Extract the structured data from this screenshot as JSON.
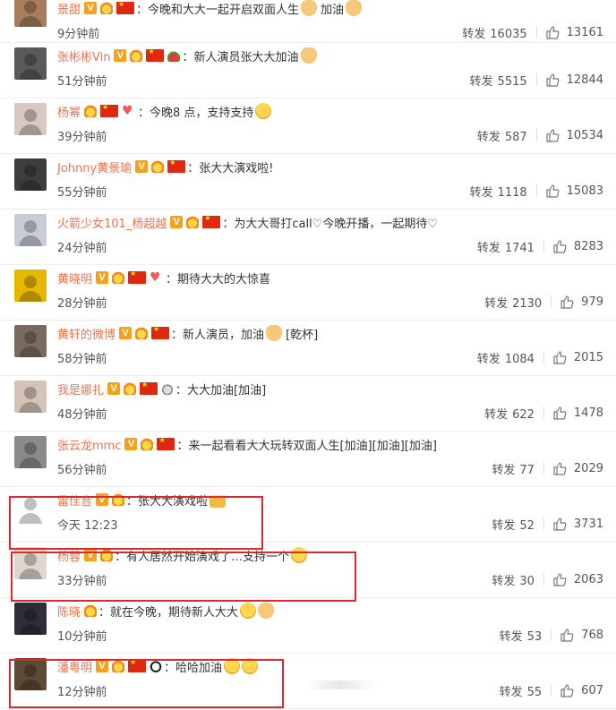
{
  "forward_label": "转发",
  "comments": [
    {
      "name": "景甜",
      "badges": [
        "vip",
        "crown",
        "flag"
      ],
      "text": "今晚和大大一起开启双面人生",
      "emojis": [
        "hand"
      ],
      "extra": "加油",
      "extra_emoji": "hand",
      "time": "9分钟前",
      "forwards": "16035",
      "likes": "13161",
      "avatar": "#a87c5c"
    },
    {
      "name": "张彬彬Vin",
      "badges": [
        "vip",
        "crown",
        "flag",
        "melon"
      ],
      "text": "新人演员张大大加油",
      "emojis": [
        "hand"
      ],
      "time": "51分钟前",
      "forwards": "5515",
      "likes": "12844",
      "avatar": "#5a5a5a"
    },
    {
      "name": "杨幂",
      "badges": [
        "crown",
        "flag",
        "heart"
      ],
      "text": "今晚8 点，支持支持",
      "emojis": [
        "face"
      ],
      "time": "39分钟前",
      "forwards": "587",
      "likes": "10534",
      "avatar": "#d9c7c1"
    },
    {
      "name": "Johnny黄景瑜",
      "badges": [
        "vip",
        "crown",
        "flag"
      ],
      "text": "张大大演戏啦!",
      "emojis": [],
      "time": "55分钟前",
      "forwards": "1118",
      "likes": "15083",
      "avatar": "#3d3d3d"
    },
    {
      "name": "火箭少女101_杨超越",
      "badges": [
        "vip",
        "crown",
        "flag"
      ],
      "text": "为大大哥打call♡今晚开播，一起期待♡",
      "emojis": [],
      "time": "24分钟前",
      "forwards": "1741",
      "likes": "8283",
      "avatar": "#c8ccd6"
    },
    {
      "name": "黄晓明",
      "badges": [
        "vip",
        "crown",
        "flag",
        "heart"
      ],
      "text": "期待大大的大惊喜",
      "emojis": [],
      "time": "28分钟前",
      "forwards": "2130",
      "likes": "979",
      "avatar": "#e6b800"
    },
    {
      "name": "黄轩的微博",
      "badges": [
        "vip",
        "crown",
        "flag"
      ],
      "text": "新人演员，加油",
      "emojis": [
        "hand"
      ],
      "extra": "[乾杯]",
      "time": "58分钟前",
      "forwards": "1084",
      "likes": "2015",
      "avatar": "#7a6a5e"
    },
    {
      "name": "我是娜扎",
      "badges": [
        "vip",
        "crown",
        "flag",
        "medal"
      ],
      "text": "大大加油[加油]",
      "emojis": [],
      "time": "48分钟前",
      "forwards": "622",
      "likes": "1478",
      "avatar": "#d4c4b8"
    },
    {
      "name": "张云龙mmc",
      "badges": [
        "vip",
        "crown",
        "flag"
      ],
      "text": "来一起看看大大玩转双面人生[加油][加油][加油]",
      "emojis": [],
      "time": "56分钟前",
      "forwards": "77",
      "likes": "2029",
      "avatar": "#8a8a8a"
    },
    {
      "name": "雷佳音",
      "badges": [
        "vip",
        "crown"
      ],
      "text": "张大大演戏啦",
      "emojis": [
        "beer"
      ],
      "time": "今天 12:23",
      "forwards": "52",
      "likes": "3731",
      "avatar": "#ffffff"
    },
    {
      "name": "杨蓉",
      "badges": [
        "vip",
        "crown"
      ],
      "text": "有人居然开始演戏了…支持一个",
      "emojis": [
        "face"
      ],
      "time": "33分钟前",
      "forwards": "30",
      "likes": "2063",
      "avatar": "#e0d6cf"
    },
    {
      "name": "陈晓",
      "badges": [
        "crown"
      ],
      "text": "就在今晚，期待新人大大",
      "emojis": [
        "face",
        "hand"
      ],
      "time": "10分钟前",
      "forwards": "53",
      "likes": "768",
      "avatar": "#2e2e3a"
    },
    {
      "name": "潘粤明",
      "badges": [
        "vip",
        "crown",
        "flag",
        "panda"
      ],
      "text": "哈哈加油",
      "emojis": [
        "face",
        "face"
      ],
      "time": "12分钟前",
      "forwards": "55",
      "likes": "607",
      "avatar": "#5c4a36"
    }
  ],
  "highlighted": [
    "雷佳音",
    "杨蓉",
    "潘粤明"
  ]
}
